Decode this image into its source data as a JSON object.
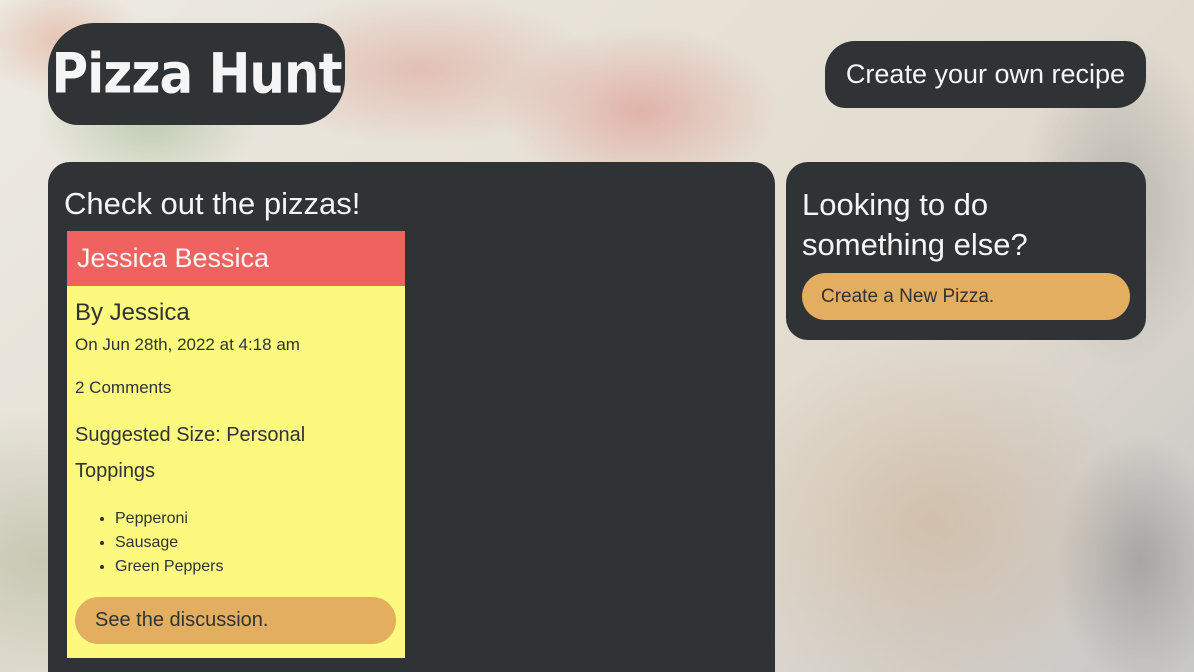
{
  "header": {
    "logo": "Pizza Hunt",
    "nav_link": "Create your own recipe"
  },
  "main": {
    "title": "Check out the pizzas!",
    "pizzas": [
      {
        "name": "Jessica Bessica",
        "author": "By Jessica",
        "date": "On Jun 28th, 2022 at 4:18 am",
        "comments": "2 Comments",
        "size": "Suggested Size: Personal",
        "toppings_label": "Toppings",
        "toppings": [
          "Pepperoni",
          "Sausage",
          "Green Peppers"
        ],
        "button": "See the discussion."
      }
    ]
  },
  "sidebar": {
    "title": "Looking to do something else?",
    "button": "Create a New Pizza."
  },
  "colors": {
    "panel": "#2f3336",
    "card_bg": "#fdf97f",
    "card_header": "#f0625f",
    "button": "#e3ae5f"
  }
}
